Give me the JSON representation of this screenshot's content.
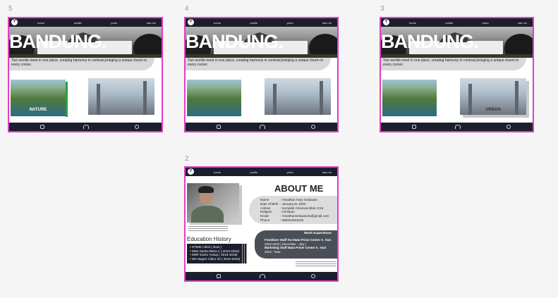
{
  "frames": {
    "f5": {
      "label": "5"
    },
    "f4": {
      "label": "4"
    },
    "f3": {
      "label": "3"
    },
    "f2": {
      "label": "2"
    }
  },
  "nav": {
    "logo": "Y",
    "links": [
      "home",
      "profile",
      "porto",
      "ask me"
    ]
  },
  "hero": {
    "title": "BANDUNG.",
    "tagline": "Two worlds meet in one place, creating harmony in contrast,bringing a unique charm to every corner."
  },
  "cards": {
    "nature": "NATURE",
    "urban": "URBAN"
  },
  "footer": {
    "icons": [
      "instagram-icon",
      "community-icon",
      "phone-icon"
    ]
  },
  "about": {
    "title": "ABOUT ME",
    "info": [
      {
        "key": "Name",
        "value": ": Yonathan Hary Sutiawan"
      },
      {
        "key": "Date of Birth",
        "value": ": January,31 2004"
      },
      {
        "key": "Adress",
        "value": ": Komplek Citramas Blok C/16"
      },
      {
        "key": "Religion",
        "value": ": Christian"
      },
      {
        "key": "Email",
        "value": ": Yonathanselawan31@gmail.com"
      },
      {
        "key": "Phone",
        "value": ": 088102364200"
      }
    ],
    "education_title": "Education History",
    "education": [
      "• STMIK Likmi ( Now )",
      "• SMA Santa Maria 2 ( 2019-2022)",
      "• SMP Santo Yusup ( 2016-2019)",
      "• SD Negeri Cibiru 03 ( 2010-2016)"
    ],
    "work_title": "Work Experience",
    "work": [
      {
        "role": "Frontliner Staff KU Mata Prime Center A. Yani",
        "period": "2022-2023     | December - July |"
      },
      {
        "role": "Marketing Staff Mata Prime Center A. Yani",
        "period": "2023 - Now"
      }
    ]
  },
  "colors": {
    "frame_border": "#e43cc4",
    "navbar": "#1b1f2c",
    "canvas": "#f5f5f5"
  }
}
